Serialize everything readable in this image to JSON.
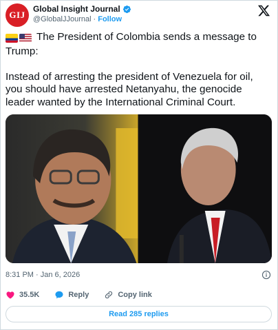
{
  "author": {
    "avatar_text": "GIJ",
    "display_name": "Global Insight Journal",
    "handle": "@GlobalJJournal",
    "separator": "·",
    "follow_label": "Follow"
  },
  "tweet": {
    "line1": "The President of Colombia sends a message to Trump:",
    "line2": "Instead of arresting the president of Venezuela for oil, you should have arrested Netanyahu, the genocide leader wanted by the International Criminal Court.",
    "flags": [
      "colombia-flag",
      "united-states-flag"
    ]
  },
  "meta": {
    "timestamp": "8:31 PM · Jan 6, 2026"
  },
  "actions": {
    "likes": "35.5K",
    "reply_label": "Reply",
    "copy_label": "Copy link"
  },
  "replies_button": "Read 285 replies",
  "colors": {
    "accent": "#1d9bf0",
    "like_heart": "#f91880",
    "avatar_red": "#d91f26"
  }
}
